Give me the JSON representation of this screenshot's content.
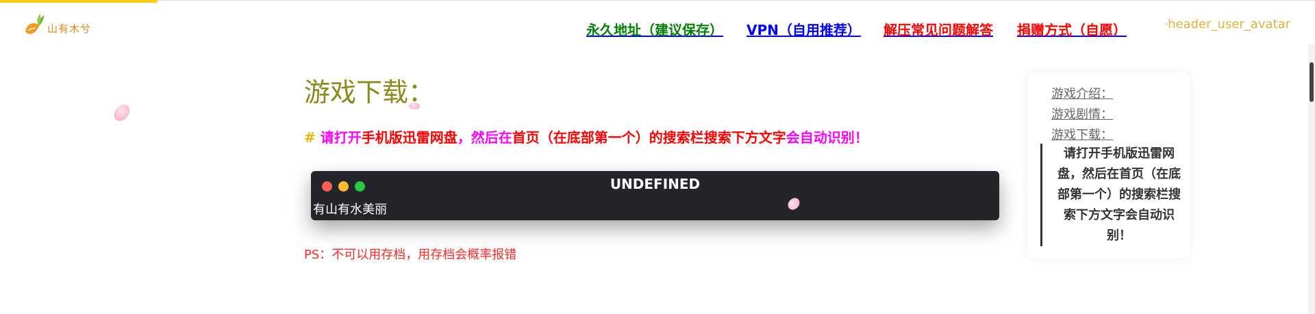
{
  "header": {
    "logo_text": "山有木兮",
    "nav": [
      {
        "label": "永久地址（建议保存）",
        "color": "#008000"
      },
      {
        "label": "VPN（自用推荐）",
        "color": "#0000ff"
      },
      {
        "label": "解压常见问题解答",
        "color": "#ff0000"
      },
      {
        "label": "捐赠方式（自愿）",
        "color": "#ff0000"
      }
    ],
    "avatar_alt": "header_user_avatar"
  },
  "main": {
    "title": "游戏下载：",
    "notice": {
      "hash": "# ",
      "segments": [
        {
          "text": "请打开",
          "color": "#ff00ff"
        },
        {
          "text": "手机版迅雷网盘",
          "color": "#ff0000"
        },
        {
          "text": "，然后在",
          "color": "#ff00ff"
        },
        {
          "text": "首页（在底部第一个）的搜索栏搜索下方文字",
          "color": "#ff0000"
        },
        {
          "text": "会自动识别！",
          "color": "#ff00ff"
        }
      ]
    },
    "terminal": {
      "title": "UNDEFINED",
      "content": "有山有水美丽"
    },
    "ps": "PS：不可以用存档，用存档会概率报错"
  },
  "toc": {
    "items": [
      "游戏介绍：",
      "游戏剧情：",
      "游戏下载："
    ],
    "sub": "请打开手机版迅雷网盘，然后在首页（在底部第一个）的搜索栏搜索下方文字会自动识别！"
  },
  "colors": {
    "accent": "#f5d214",
    "title": "#8a8a1e",
    "terminal_bg": "#23252b",
    "hash": "#f0b400"
  }
}
